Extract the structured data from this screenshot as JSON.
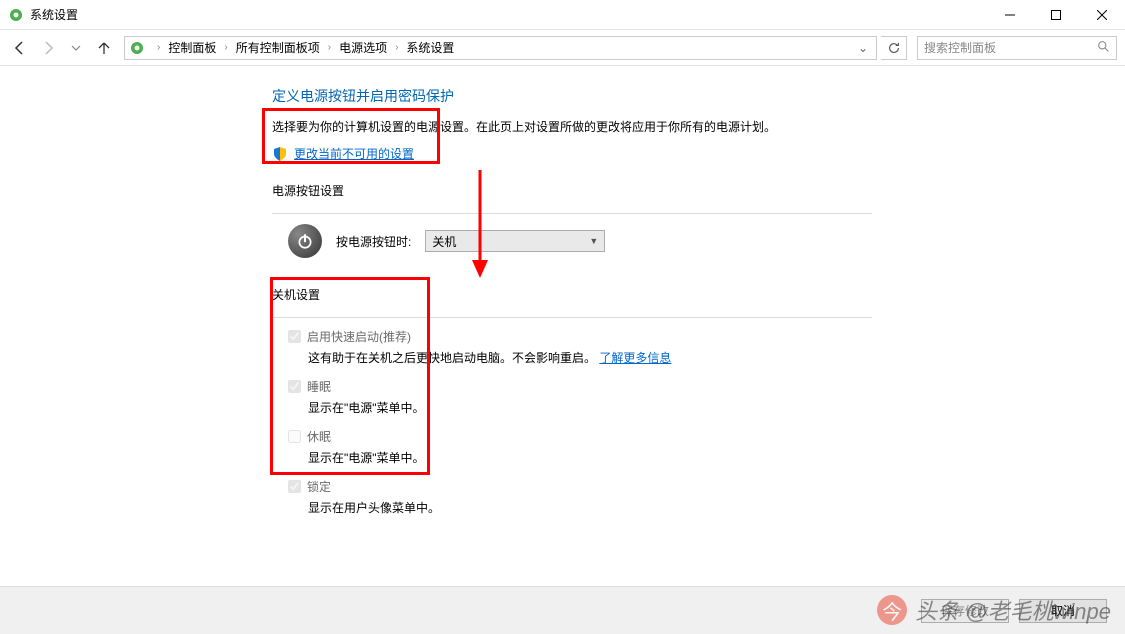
{
  "window": {
    "title": "系统设置"
  },
  "breadcrumbs": [
    "控制面板",
    "所有控制面板项",
    "电源选项",
    "系统设置"
  ],
  "search": {
    "placeholder": "搜索控制面板"
  },
  "page": {
    "heading": "定义电源按钮并启用密码保护",
    "description": "选择要为你的计算机设置的电源设置。在此页上对设置所做的更改将应用于你所有的电源计划。",
    "unlock_link": "更改当前不可用的设置"
  },
  "power_button_section": {
    "title": "电源按钮设置",
    "label": "按电源按钮时:",
    "selected": "关机"
  },
  "shutdown_section": {
    "title": "关机设置",
    "options": [
      {
        "label": "启用快速启动(推荐)",
        "checked": true,
        "desc": "这有助于在关机之后更快地启动电脑。不会影响重启。",
        "link": "了解更多信息"
      },
      {
        "label": "睡眠",
        "checked": true,
        "desc": "显示在\"电源\"菜单中。"
      },
      {
        "label": "休眠",
        "checked": false,
        "desc": "显示在\"电源\"菜单中。"
      },
      {
        "label": "锁定",
        "checked": true,
        "desc": "显示在用户头像菜单中。"
      }
    ]
  },
  "footer": {
    "save": "保存修改",
    "cancel": "取消"
  },
  "watermark": "头条 @老毛桃winpe"
}
